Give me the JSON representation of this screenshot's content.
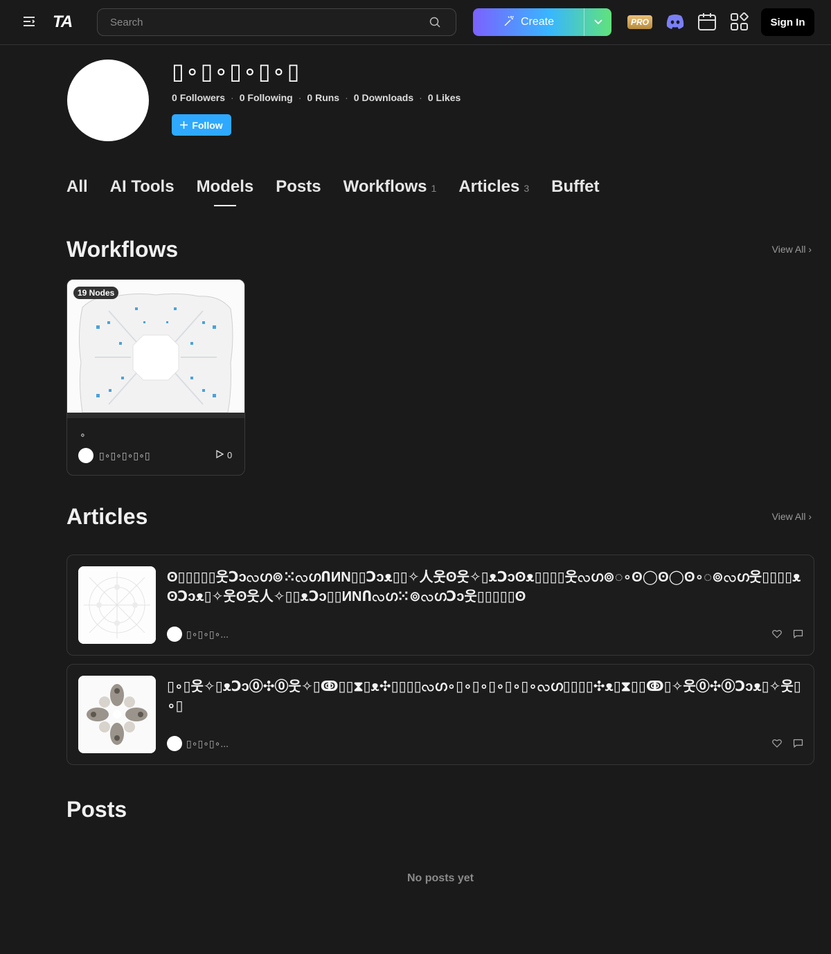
{
  "header": {
    "logo": "TA",
    "search_placeholder": "Search",
    "create_label": "Create",
    "pro_label": "PRO",
    "signin_label": "Sign In"
  },
  "profile": {
    "name": "▯∘▯∘▯∘▯∘▯",
    "stats": [
      {
        "value": "0",
        "label": "Followers"
      },
      {
        "value": "0",
        "label": "Following"
      },
      {
        "value": "0",
        "label": "Runs"
      },
      {
        "value": "0",
        "label": "Downloads"
      },
      {
        "value": "0",
        "label": "Likes"
      }
    ],
    "follow_label": "Follow"
  },
  "tabs": [
    {
      "label": "All",
      "count": ""
    },
    {
      "label": "AI Tools",
      "count": ""
    },
    {
      "label": "Models",
      "count": "",
      "active": true
    },
    {
      "label": "Posts",
      "count": ""
    },
    {
      "label": "Workflows",
      "count": "1"
    },
    {
      "label": "Articles",
      "count": "3"
    },
    {
      "label": "Buffet",
      "count": ""
    }
  ],
  "workflows": {
    "title": "Workflows",
    "view_all": "View All",
    "cards": [
      {
        "nodes": "19 Nodes",
        "title": "∘",
        "author": "▯∘▯∘▯∘▯∘▯",
        "runs": "0"
      }
    ]
  },
  "articles": {
    "title": "Articles",
    "view_all": "View All",
    "items": [
      {
        "title": "ʘ▯▯▯▯▯웃Ↄↄလഗ⊚⁙လഗՈИN▯▯Ↄↄᴥ▯▯✧人웃ʘ웃✧▯ᴥↃↄʘᴥ▯▯▯▯웃လഗ⊚◌∘ʘ◯ʘ◯ʘ∘◌⊚လഗ웃▯▯▯▯ᴥʘↃↄᴥ▯✧웃ʘ웃人✧▯▯ᴥↃↄ▯▯ИNՈလഗ⁙⊚လഗↃↄ웃▯▯▯▯▯ʘ",
        "author": "▯∘▯∘▯∘..."
      },
      {
        "title": "▯∘▯웃✧▯ᴥↃↄ⓪✣⓪웃✧▯ↂ▯▯⧗▯ᴥ✣▯▯▯▯လഗ∘▯∘▯∘▯∘▯∘▯∘လഗ▯▯▯▯✣ᴥ▯⧗▯▯ↂ▯✧웃⓪✣⓪Ↄↄᴥ▯✧웃▯∘▯",
        "author": "▯∘▯∘▯∘..."
      }
    ]
  },
  "posts": {
    "title": "Posts",
    "empty": "No posts yet"
  },
  "colors": {
    "background": "#1a1a1a",
    "follow": "#2ea9ff",
    "create_gradient": [
      "#7b61ff",
      "#38b6ff",
      "#61e27b"
    ],
    "discord": "#7b7ff5"
  },
  "icons": [
    "menu-icon",
    "search-icon",
    "wand-icon",
    "chevron-down-icon",
    "discord-icon",
    "calendar-icon",
    "apps-icon",
    "plus-icon",
    "play-icon",
    "heart-icon",
    "comment-icon",
    "chevron-right-icon"
  ]
}
